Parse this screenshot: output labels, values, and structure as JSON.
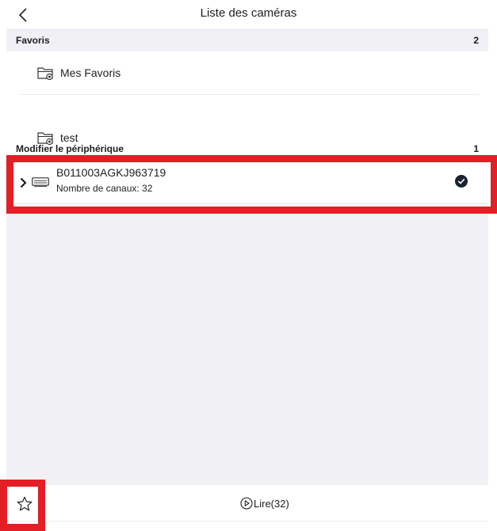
{
  "header": {
    "title": "Liste des caméras",
    "back_icon": "chevron-left-icon"
  },
  "favorites": {
    "title": "Favoris",
    "count": "2",
    "items": [
      {
        "label": "Mes Favoris",
        "icon": "folder-star-icon"
      },
      {
        "label": "test",
        "icon": "folder-star-icon"
      }
    ]
  },
  "devices": {
    "title": "Modifier le périphérique",
    "count": "1",
    "items": [
      {
        "name": "B011003AGKJ963719",
        "channels": "Nombre de canaux: 32",
        "selected": true,
        "icon": "dvr-icon"
      }
    ]
  },
  "bottom": {
    "play_label": "Lire(32)",
    "favorite_icon": "star-outline-icon",
    "play_icon": "play-circle-icon"
  },
  "colors": {
    "highlight": "#e31e24",
    "background_panel": "#f1f1f5",
    "check": "#1b2233"
  }
}
